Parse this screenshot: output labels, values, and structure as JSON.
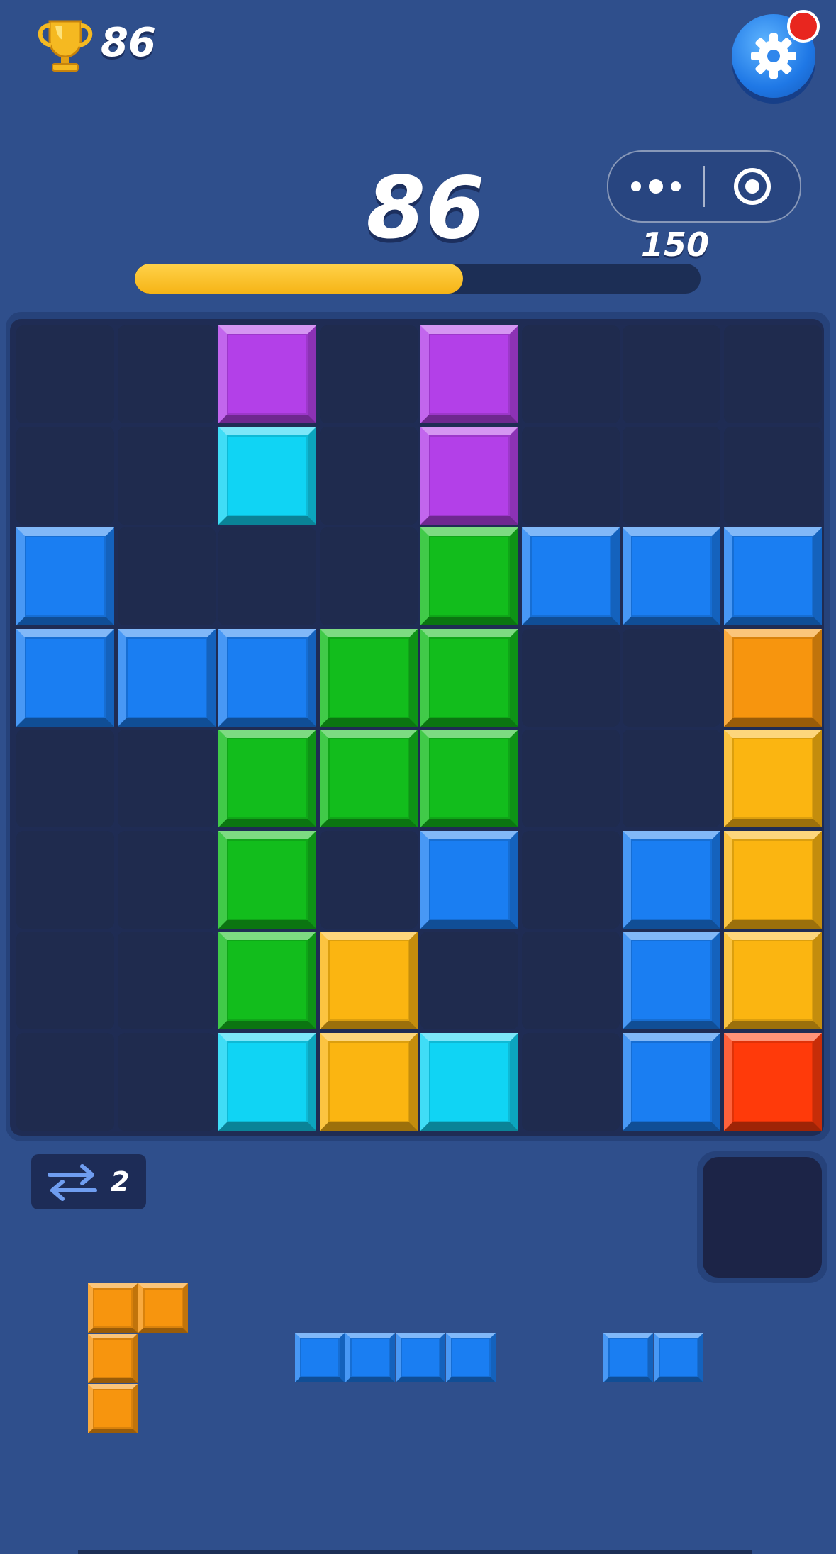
{
  "header": {
    "best_score": "86",
    "score": "86",
    "target": "150",
    "progress": 0.58,
    "has_notification": true
  },
  "capsule": {
    "more_icon": "more-dots-icon",
    "close_icon": "target-circle-icon"
  },
  "board": {
    "rows": 8,
    "cols": 8,
    "grid": [
      [
        null,
        null,
        "purple",
        null,
        "purple",
        null,
        null,
        null
      ],
      [
        null,
        null,
        "cyan",
        null,
        "purple",
        null,
        null,
        null
      ],
      [
        "blue",
        null,
        null,
        null,
        "green",
        "blue",
        "blue",
        "blue"
      ],
      [
        "blue",
        "blue",
        "blue",
        "green",
        "green",
        null,
        null,
        "orange"
      ],
      [
        null,
        null,
        "green",
        "green",
        "green",
        null,
        null,
        "amber"
      ],
      [
        null,
        null,
        "green",
        null,
        "blue",
        null,
        "blue",
        "amber"
      ],
      [
        null,
        null,
        "green",
        "amber",
        null,
        null,
        "blue",
        "amber"
      ],
      [
        null,
        null,
        "cyan",
        "amber",
        "cyan",
        null,
        "blue",
        "red"
      ]
    ]
  },
  "swap": {
    "icon": "swap-arrows-icon",
    "count": "2"
  },
  "hold_slot": {
    "empty": true
  },
  "pieces": [
    {
      "name": "l-piece",
      "color": "orange",
      "cells": [
        [
          0,
          0
        ],
        [
          0,
          1
        ],
        [
          1,
          0
        ],
        [
          2,
          0
        ]
      ]
    },
    {
      "name": "i4-piece",
      "color": "blue",
      "cells": [
        [
          0,
          0
        ],
        [
          0,
          1
        ],
        [
          0,
          2
        ],
        [
          0,
          3
        ]
      ]
    },
    {
      "name": "i2-piece",
      "color": "blue",
      "cells": [
        [
          0,
          0
        ],
        [
          0,
          1
        ]
      ]
    }
  ],
  "colors": {
    "background": "#2f4f8c",
    "progress": "#f6b416",
    "notification": "#e8261f",
    "purple": "#b340e8",
    "cyan": "#10d4f4",
    "blue": "#1a7ef2",
    "green": "#12bd1c",
    "orange": "#f7950e",
    "amber": "#fbb511",
    "red": "#ff3a0a"
  }
}
